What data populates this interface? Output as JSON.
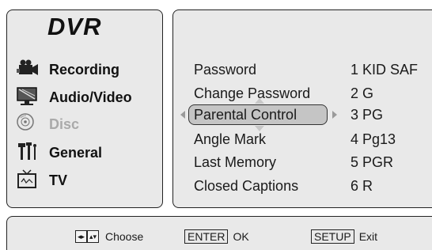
{
  "app": {
    "title": "DVR"
  },
  "sidebar": {
    "items": [
      {
        "label": "Recording",
        "icon": "camcorder-icon",
        "enabled": true
      },
      {
        "label": "Audio/Video",
        "icon": "monitor-icon",
        "enabled": true
      },
      {
        "label": "Disc",
        "icon": "disc-icon",
        "enabled": false
      },
      {
        "label": "General",
        "icon": "tools-icon",
        "enabled": true
      },
      {
        "label": "TV",
        "icon": "tv-icon",
        "enabled": true
      }
    ]
  },
  "menu": {
    "rows": [
      {
        "label": "Password",
        "value": "1 KID SAF"
      },
      {
        "label": "Change Password",
        "value": "2 G"
      },
      {
        "label": "Parental Control",
        "value": "3 PG"
      },
      {
        "label": "Angle Mark",
        "value": "4 Pg13"
      },
      {
        "label": "Last Memory",
        "value": "5 PGR"
      },
      {
        "label": "Closed Captions",
        "value": "6 R"
      }
    ],
    "selected_row": "Parental Control"
  },
  "footer": {
    "choose_label": "Choose",
    "enter_key": "ENTER",
    "enter_label": "OK",
    "setup_key": "SETUP",
    "setup_label": "Exit",
    "nav_left_right_glyph": "◂▸",
    "nav_up_down_glyph": "▴▾"
  }
}
